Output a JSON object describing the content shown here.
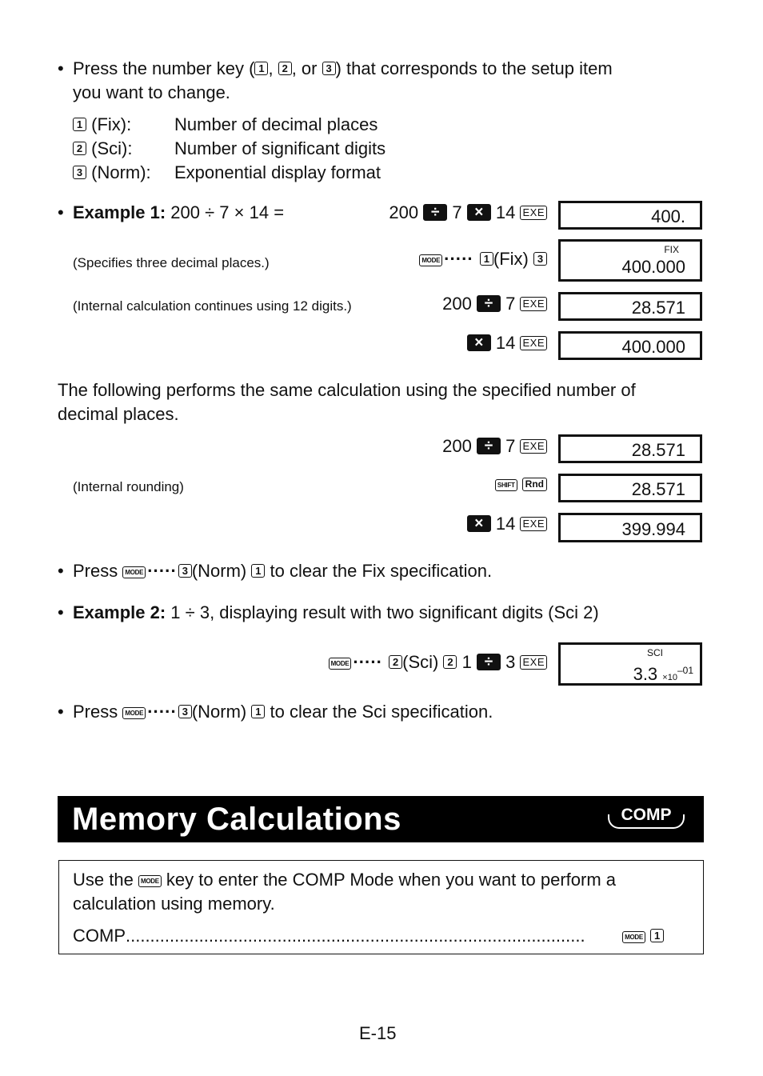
{
  "setup_intro": {
    "line1_pre": "Press the number key (",
    "key1": "1",
    "sep1": ",",
    "key2": "2",
    "sep2": ", or",
    "key3": "3",
    "line1_post": ") that corresponds to the setup item",
    "line2": "you want to change."
  },
  "setup_items": [
    {
      "key": "1",
      "name": "(Fix):",
      "desc": "Number of decimal places"
    },
    {
      "key": "2",
      "name": "(Sci):",
      "desc": "Number of significant digits"
    },
    {
      "key": "3",
      "name": "(Norm):",
      "desc": "Exponential display format"
    }
  ],
  "example1": {
    "label": "Example 1:",
    "expression": "200 ÷ 7 × 14 =",
    "steps": [
      {
        "note": "",
        "keys": {
          "n1": "200",
          "op1": "÷",
          "n2": "7",
          "op2": "×",
          "n3": "14",
          "exe": "EXE"
        },
        "display": "400.",
        "indicator": ""
      },
      {
        "note": "(Specifies three decimal places.)",
        "keys": {
          "mode": "MODE",
          "dots": "·····",
          "k1": "1",
          "lbl": "(Fix)",
          "k2": "3"
        },
        "display": "400.000",
        "indicator": "FIX"
      },
      {
        "note": "(Internal calculation continues using 12 digits.)",
        "keys": {
          "n1": "200",
          "op1": "÷",
          "n2": "7",
          "exe": "EXE"
        },
        "display": "28.571",
        "indicator": ""
      },
      {
        "note": "",
        "keys": {
          "op1": "×",
          "n1": "14",
          "exe": "EXE"
        },
        "display": "400.000",
        "indicator": ""
      }
    ]
  },
  "paragraph": {
    "line1": "The following performs the same calculation using the specified number of",
    "line2": "decimal places."
  },
  "example1b": {
    "steps": [
      {
        "note": "",
        "keys": {
          "n1": "200",
          "op1": "÷",
          "n2": "7",
          "exe": "EXE"
        },
        "display": "28.571"
      },
      {
        "note": "(Internal rounding)",
        "keys": {
          "shift": "SHIFT",
          "rnd": "Rnd"
        },
        "display": "28.571"
      },
      {
        "note": "",
        "keys": {
          "op1": "×",
          "n1": "14",
          "exe": "EXE"
        },
        "display": "399.994"
      }
    ]
  },
  "clear_fix": {
    "pre": "Press",
    "mode": "MODE",
    "dots": "·····",
    "key3": "3",
    "lbl": "(Norm)",
    "key1": "1",
    "post": "to clear the Fix specification."
  },
  "example2": {
    "label": "Example 2:",
    "desc": "1 ÷ 3, displaying result with two significant digits (Sci 2)",
    "keys": {
      "mode": "MODE",
      "dots": "·····",
      "k1": "2",
      "lbl": "(Sci)",
      "k2": "2",
      "n1": "1",
      "op": "÷",
      "n2": "3",
      "exe": "EXE"
    },
    "display_mantissa": "3.3",
    "display_times": "×10",
    "display_exponent": "–01",
    "indicator": "SCI"
  },
  "clear_sci": {
    "pre": "Press",
    "mode": "MODE",
    "dots": "·····",
    "key3": "3",
    "lbl": "(Norm)",
    "key1": "1",
    "post": "to clear the Sci specification."
  },
  "section": {
    "title": "Memory Calculations",
    "badge": "COMP"
  },
  "infobox": {
    "pre": "Use the",
    "key": "MODE",
    "post": "key to enter the COMP Mode when you want to perform a",
    "line2": "calculation using memory.",
    "mode_name": "COMP",
    "leader": "..............................................................................................",
    "mode_key": "MODE",
    "num_key": "1"
  },
  "page_number": "E-15"
}
